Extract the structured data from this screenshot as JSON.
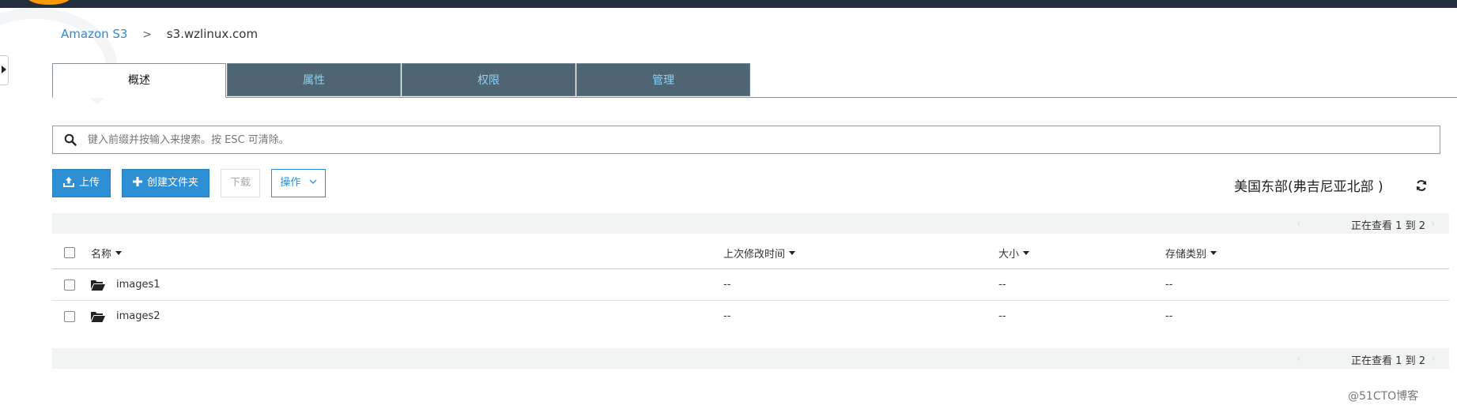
{
  "breadcrumb": {
    "root": "Amazon S3",
    "separator": ">",
    "current": "s3.wzlinux.com"
  },
  "tabs": [
    {
      "label": "概述",
      "active": true
    },
    {
      "label": "属性",
      "active": false
    },
    {
      "label": "权限",
      "active": false
    },
    {
      "label": "管理",
      "active": false
    }
  ],
  "search": {
    "placeholder": "键入前缀并按输入来搜索。按 ESC 可清除。",
    "value": ""
  },
  "toolbar": {
    "upload_label": "上传",
    "create_folder_label": "创建文件夹",
    "download_label": "下载",
    "actions_label": "操作"
  },
  "region": "美国东部(弗吉尼亚北部 )",
  "pagination": {
    "top_text": "正在查看 1 到 2",
    "bottom_text": "正在查看 1 到 2"
  },
  "table": {
    "columns": [
      "名称",
      "上次修改时间",
      "大小",
      "存储类别"
    ],
    "rows": [
      {
        "name": "images1",
        "modified": "--",
        "size": "--",
        "storage_class": "--"
      },
      {
        "name": "images2",
        "modified": "--",
        "size": "--",
        "storage_class": "--"
      }
    ]
  },
  "watermark": "@51CTO博客",
  "colors": {
    "topbar": "#232f3e",
    "accent": "#2f8fd4",
    "tab_inactive_bg": "#4f6573",
    "tab_inactive_text": "#8ad2f5"
  }
}
